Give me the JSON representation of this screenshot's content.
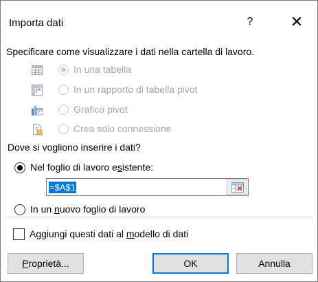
{
  "dialog": {
    "title": "Importa dati",
    "help_glyph": "?",
    "close_glyph": "✕"
  },
  "instruction": "Specificare come visualizzare i dati nella cartella di lavoro.",
  "view_options": [
    {
      "label": "In una tabella",
      "icon": "table-icon",
      "selected": true,
      "enabled": false
    },
    {
      "label": "In un rapporto di tabella pivot",
      "icon": "pivot-table-icon",
      "selected": false,
      "enabled": false
    },
    {
      "label": "Grafico pivot",
      "icon": "pivot-chart-icon",
      "selected": false,
      "enabled": false
    },
    {
      "label": "Crea solo connessione",
      "icon": "connection-only-icon",
      "selected": false,
      "enabled": false
    }
  ],
  "location": {
    "prompt": "Dove si vogliono inserire i dati?",
    "existing_pre": "Nel foglio di lavoro e",
    "existing_key": "s",
    "existing_post": "istente:",
    "existing_selected": true,
    "cell_reference": "=$A$1",
    "new_pre": "In un ",
    "new_key": "n",
    "new_post": "uovo foglio di lavoro",
    "new_selected": false
  },
  "data_model": {
    "pre": "Aggiungi questi dati al ",
    "key": "m",
    "post": "odello di dati",
    "checked": false
  },
  "buttons": {
    "properties_key": "P",
    "properties_rest": "roprietà...",
    "ok": "OK",
    "cancel": "Annulla"
  },
  "colors": {
    "accent": "#0078d7",
    "disabled_text": "#a6a6a6",
    "button_bg": "#e1e1e1"
  }
}
